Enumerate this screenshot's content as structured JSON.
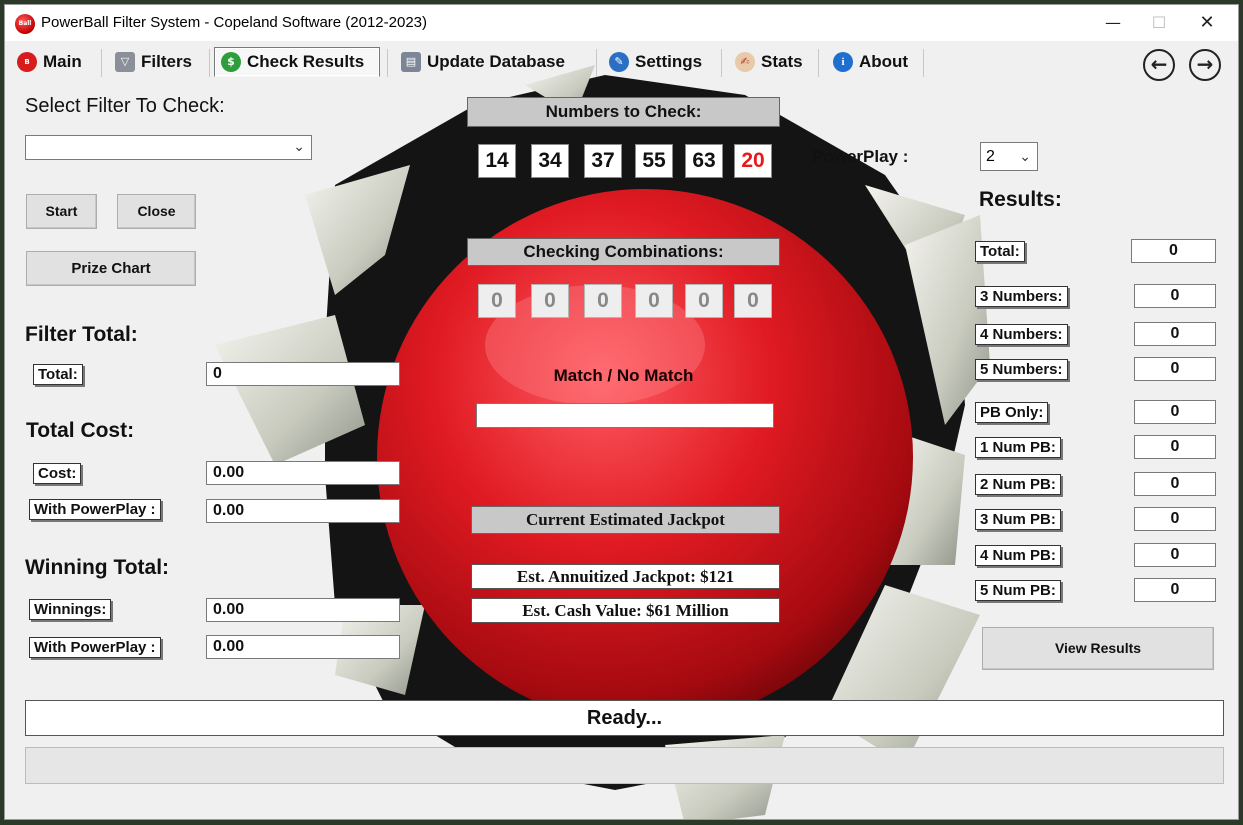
{
  "window": {
    "title": "PowerBall Filter System - Copeland Software (2012-2023)",
    "app_icon_text": "Ball"
  },
  "tabs": [
    {
      "label": "Main",
      "icon": "powerball-icon"
    },
    {
      "label": "Filters",
      "icon": "funnel-icon"
    },
    {
      "label": "Check Results",
      "icon": "dollar-icon",
      "active": true
    },
    {
      "label": "Update Database",
      "icon": "database-icon"
    },
    {
      "label": "Settings",
      "icon": "wrench-icon"
    },
    {
      "label": "Stats",
      "icon": "stats-icon"
    },
    {
      "label": "About",
      "icon": "info-icon"
    }
  ],
  "left": {
    "select_heading": "Select Filter To Check:",
    "filter_select_value": "",
    "start_button": "Start",
    "close_button": "Close",
    "prize_chart_button": "Prize Chart",
    "filter_total_heading": "Filter Total:",
    "total_label": "Total:",
    "total_value": "0",
    "total_cost_heading": "Total Cost:",
    "cost_label": "Cost:",
    "cost_value": "0.00",
    "cost_pp_label": "With PowerPlay :",
    "cost_pp_value": "0.00",
    "winning_heading": "Winning Total:",
    "winnings_label": "Winnings:",
    "winnings_value": "0.00",
    "win_pp_label": "With PowerPlay :",
    "win_pp_value": "0.00"
  },
  "center": {
    "numbers_heading": "Numbers to Check:",
    "numbers": [
      "14",
      "34",
      "37",
      "55",
      "63"
    ],
    "powerball_number": "20",
    "combos_heading": "Checking Combinations:",
    "combos": [
      "0",
      "0",
      "0",
      "0",
      "0",
      "0"
    ],
    "match_label": "Match / No Match",
    "match_value": "",
    "jackpot_heading": "Current Estimated Jackpot",
    "annuitized": "Est. Annuitized Jackpot: $121",
    "cash_value": "Est. Cash Value: $61 Million"
  },
  "right": {
    "powerplay_label": "PowerPlay :",
    "powerplay_value": "2",
    "results_heading": "Results:",
    "rows": [
      {
        "label": "Total:",
        "value": "0"
      },
      {
        "label": "3 Numbers:",
        "value": "0"
      },
      {
        "label": "4 Numbers:",
        "value": "0"
      },
      {
        "label": "5 Numbers:",
        "value": "0"
      },
      {
        "label": "PB Only:",
        "value": "0"
      },
      {
        "label": "1 Num PB:",
        "value": "0"
      },
      {
        "label": "2 Num PB:",
        "value": "0"
      },
      {
        "label": "3 Num PB:",
        "value": "0"
      },
      {
        "label": "4 Num PB:",
        "value": "0"
      },
      {
        "label": "5 Num PB:",
        "value": "0"
      }
    ],
    "view_results_button": "View Results"
  },
  "status": {
    "text": "Ready...",
    "progress": 0
  },
  "colors": {
    "powerball_red": "#e8191a",
    "window_bg": "#f0f0f0",
    "header_gray": "#c8c8c8"
  }
}
